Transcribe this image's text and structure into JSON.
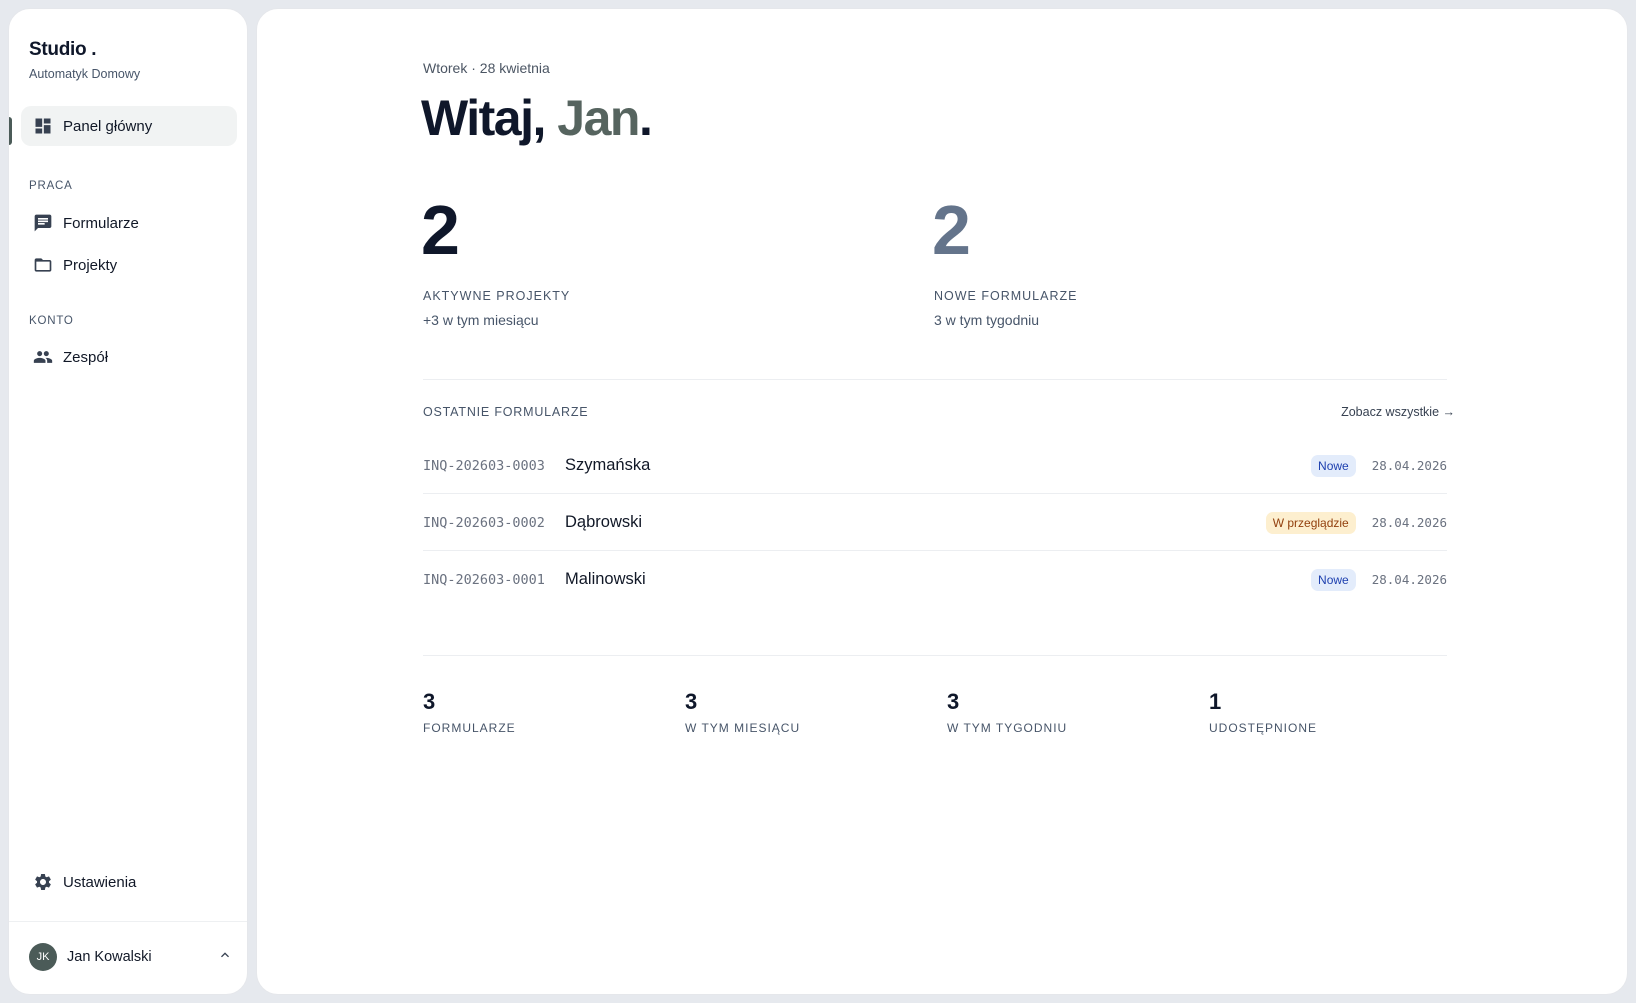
{
  "sidebar": {
    "brand": "Studio .",
    "subtitle": "Automatyk Domowy",
    "nav_main": {
      "label": "Panel główny",
      "icon": "dashboard-icon"
    },
    "section_work": "PRACA",
    "nav_forms": {
      "label": "Formularze",
      "icon": "message-icon"
    },
    "nav_projects": {
      "label": "Projekty",
      "icon": "folder-icon"
    },
    "section_account": "KONTO",
    "nav_team": {
      "label": "Zespół",
      "icon": "people-icon"
    },
    "nav_settings": {
      "label": "Ustawienia",
      "icon": "gear-icon"
    },
    "user": {
      "initials": "JK",
      "name": "Jan Kowalski"
    }
  },
  "main": {
    "date": "Wtorek · 28 kwietnia",
    "greeting_prefix": "Witaj, ",
    "greeting_name": "Jan",
    "greeting_suffix": ".",
    "stats": [
      {
        "value": "2",
        "label": "AKTYWNE PROJEKTY",
        "sub": "+3 w tym miesiącu",
        "color": "#0f172a"
      },
      {
        "value": "2",
        "label": "NOWE FORMULARZE",
        "sub": "3 w tym tygodniu",
        "color": "#64748b"
      }
    ],
    "recent_title": "OSTATNIE FORMULARZE",
    "see_all": "Zobacz wszystkie →",
    "rows": [
      {
        "id": "INQ-202603-0003",
        "name": "Szymańska",
        "status": "Nowe",
        "date": "28.04.2026"
      },
      {
        "id": "INQ-202603-0002",
        "name": "Dąbrowski",
        "status": "W przeglądzie",
        "date": "28.04.2026"
      },
      {
        "id": "INQ-202603-0001",
        "name": "Malinowski",
        "status": "Nowe",
        "date": "28.04.2026"
      }
    ],
    "mini_stats": [
      {
        "value": "3",
        "label": "FORMULARZE"
      },
      {
        "value": "3",
        "label": "W TYM MIESIĄCU"
      },
      {
        "value": "3",
        "label": "W TYM TYGODNIU"
      },
      {
        "value": "1",
        "label": "UDOSTĘPNIONE"
      }
    ]
  }
}
